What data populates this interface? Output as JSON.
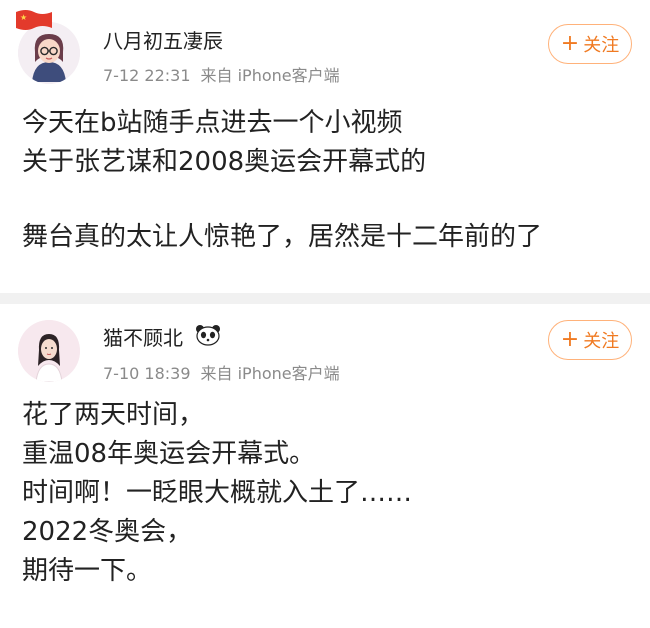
{
  "posts": [
    {
      "username": "八月初五凄辰",
      "time": "7-12 22:31",
      "source": "来自 iPhone客户端",
      "follow_label": "关注",
      "lines": [
        "今天在b站随手点进去一个小视频",
        "关于张艺谋和2008奥运会开幕式的",
        "",
        "舞台真的太让人惊艳了，居然是十二年前的了"
      ]
    },
    {
      "username": "猫不顾北",
      "time": "7-10 18:39",
      "source": "来自 iPhone客户端",
      "follow_label": "关注",
      "lines": [
        "花了两天时间，",
        "重温08年奥运会开幕式。",
        "时间啊！一眨眼大概就入土了……",
        "2022冬奥会，",
        "期待一下。"
      ]
    }
  ],
  "colors": {
    "accent": "#f07a22",
    "follow_border": "#ffb27a",
    "meta": "#8a8a8a",
    "separator": "#f1f1f1"
  },
  "icons": {
    "flag": "china-flag-icon",
    "panda": "panda-emoji-icon",
    "follow_plus": "plus-icon"
  }
}
